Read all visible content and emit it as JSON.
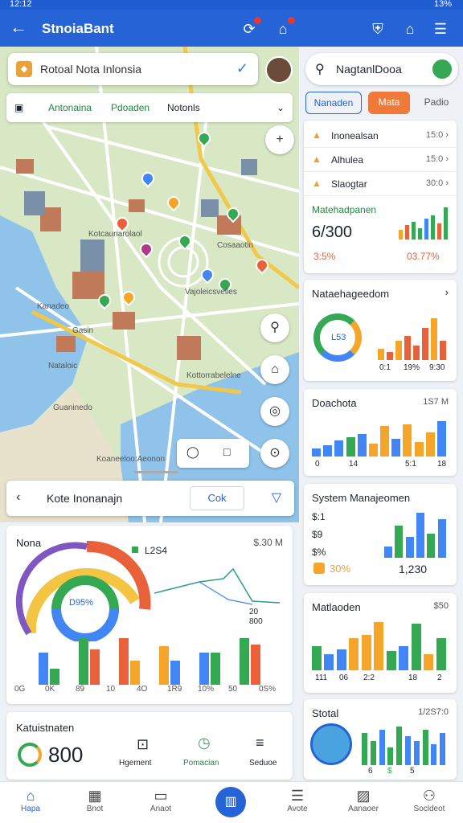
{
  "status": {
    "time": "12:12",
    "battery": "13%"
  },
  "appbar": {
    "title": "StnoiaBant"
  },
  "map": {
    "search_text": "Rotoal Nota Inlonsia",
    "tabs": [
      "Antonaina",
      "Pdoaden",
      "Notonls"
    ],
    "labels": [
      "Kotcaunarolaol",
      "Cosaaotin",
      "Vajoleicsvelles",
      "Kanadeo",
      "Gasin",
      "Nataloic",
      "Guaninedo",
      "Kottorrabelelne",
      "Koaneeloo:Aeonon"
    ],
    "sheet_text": "Kote Inonanajn",
    "sheet_ok": "Cok"
  },
  "left_chart": {
    "title": "Nona",
    "value": "$.30 M",
    "legend": "L2S4",
    "center": "D95%",
    "line_labels": [
      "20",
      "800"
    ],
    "bar_labels": [
      "0G",
      "0K",
      "89",
      "10",
      "4O",
      "1R9",
      "10%",
      "50",
      "0S%"
    ],
    "bars": [
      [
        40,
        20
      ],
      [
        58,
        44
      ],
      [
        58,
        30
      ],
      [
        48,
        30
      ],
      [
        40,
        40
      ],
      [
        58,
        50
      ]
    ]
  },
  "stats": {
    "title": "Katuistnaten",
    "value": "800",
    "items": [
      "Hgement",
      "Pomacian",
      "Seduoe"
    ]
  },
  "right": {
    "search": "NagtanlDooa",
    "chips": [
      "Nanaden",
      "Mata",
      "Padio"
    ],
    "list": [
      {
        "name": "Inonealsan",
        "val": "15:0"
      },
      {
        "name": "Alhulea",
        "val": "15:0"
      },
      {
        "name": "Slaogtar",
        "val": "30:0"
      }
    ],
    "metric": {
      "title": "Matehadpanen",
      "value": "6/300",
      "pct": "3:5%",
      "pct2": "03.77%"
    },
    "cards": [
      {
        "title": "Nataehageedom",
        "sub": "L53",
        "axis": [
          "0:1",
          "19%",
          "9:30"
        ]
      },
      {
        "title": "Doachota",
        "value": "1S7 M",
        "axis": [
          "0",
          "14",
          "5:1",
          "18"
        ]
      },
      {
        "title": "System Manajeomen",
        "rows": [
          "$:1",
          "$9",
          "$%"
        ],
        "pct": "30%",
        "val": "1,230"
      },
      {
        "title": "Matlaoden",
        "value": "$50",
        "axis": [
          "111",
          "06",
          "2:2",
          "18",
          "2"
        ]
      },
      {
        "title": "Stotal",
        "value": "1/2S7:0",
        "axis": [
          "6",
          "$",
          "5"
        ]
      }
    ]
  },
  "nav": [
    "Hapa",
    "Bnot",
    "Anaot",
    "",
    "Avote",
    "Aanaoer",
    "Socldeot"
  ],
  "colors": {
    "primary": "#2563d6",
    "green": "#34a853",
    "orange": "#f4a52a",
    "red": "#e8613a"
  }
}
